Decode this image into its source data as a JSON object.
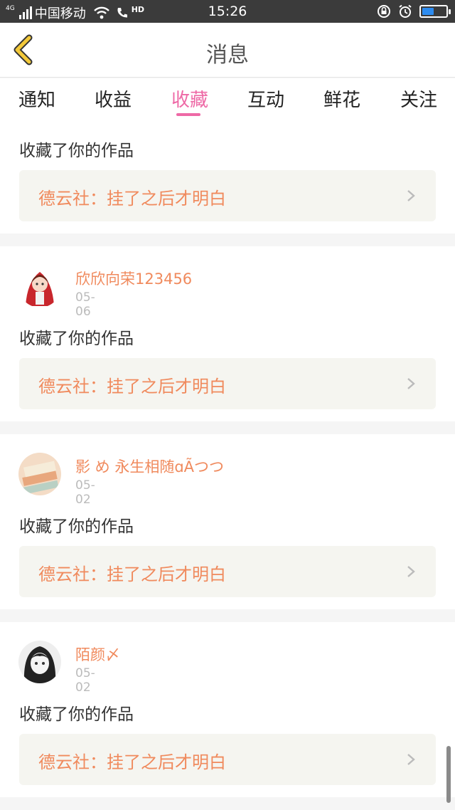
{
  "status_bar": {
    "network": "4G",
    "carrier": "中国移动",
    "hd": "HD",
    "time": "15:26",
    "battery_level": 0.5
  },
  "header": {
    "title": "消息",
    "back_icon": "chevron-left-icon",
    "accent_color": "#f3c93a"
  },
  "tabs": [
    {
      "label": "通知",
      "active": false
    },
    {
      "label": "收益",
      "active": false
    },
    {
      "label": "收藏",
      "active": true
    },
    {
      "label": "互动",
      "active": false
    },
    {
      "label": "鲜花",
      "active": false
    },
    {
      "label": "关注",
      "active": false
    }
  ],
  "colors": {
    "active_tab": "#ee69a6",
    "username": "#f08a5d",
    "work_title": "#f08a5d",
    "work_box_bg": "#f5f5f0"
  },
  "items": [
    {
      "username": "",
      "date": "",
      "message": "收藏了你的作品",
      "work_title": "德云社：挂了之后才明白"
    },
    {
      "username": "欣欣向荣123456",
      "date": "05-06",
      "message": "收藏了你的作品",
      "work_title": "德云社：挂了之后才明白",
      "avatar": "avatar-red-hood-girl"
    },
    {
      "username": "影 め 永生相随ɑÃつつ",
      "date": "05-02",
      "message": "收藏了你的作品",
      "work_title": "德云社：挂了之后才明白",
      "avatar": "avatar-books"
    },
    {
      "username": "陌颜〆",
      "date": "05-02",
      "message": "收藏了你的作品",
      "work_title": "德云社：挂了之后才明白",
      "avatar": "avatar-sketch-girl"
    }
  ]
}
